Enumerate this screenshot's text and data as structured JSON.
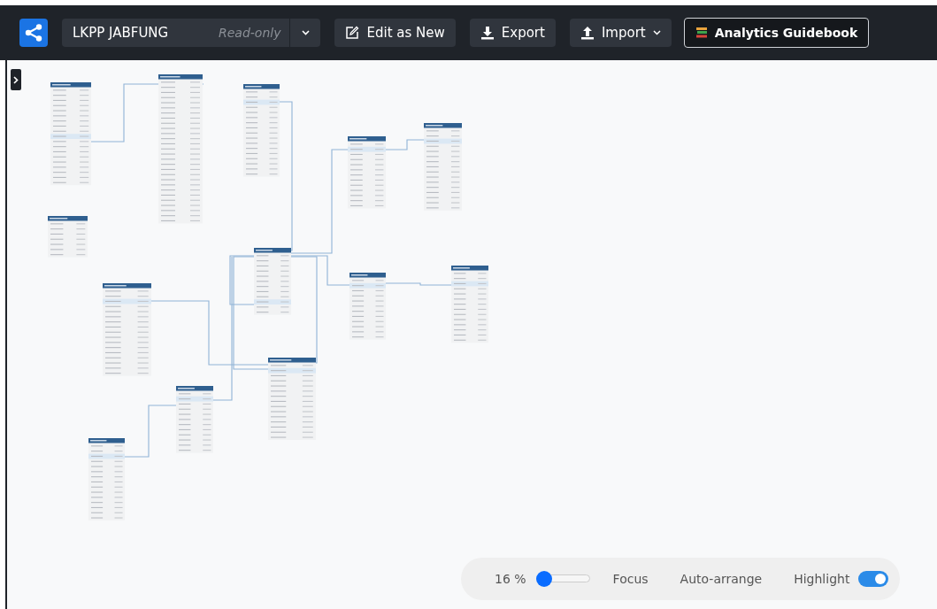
{
  "toolbar": {
    "project_name": "LKPP JABFUNG",
    "mode_badge": "Read-only",
    "buttons": [
      {
        "kind": "edit",
        "label": "Edit as New"
      },
      {
        "kind": "export",
        "label": "Export"
      },
      {
        "kind": "import",
        "label": "Import"
      },
      {
        "kind": "guide",
        "label": "Analytics Guidebook"
      }
    ]
  },
  "controls": {
    "zoom_reading": "16 %",
    "zoom": {
      "level": 0.06
    },
    "actions": [
      "Focus",
      "Auto-arrange"
    ],
    "highlight": {
      "label": "Highlight",
      "on": true
    }
  }
}
